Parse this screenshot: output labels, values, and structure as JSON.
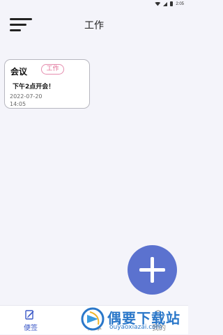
{
  "status_bar": {
    "time": "2:05"
  },
  "header": {
    "title": "工作",
    "menu_icon": "menu-icon"
  },
  "note_card": {
    "title": "会议",
    "tag": "工作",
    "body": "下午2点开会！",
    "date": "2022-07-20",
    "time": "14:05"
  },
  "fab": {
    "icon": "plus-icon"
  },
  "bottom_nav": {
    "items": [
      {
        "label": "便签",
        "icon": "note-edit-icon"
      },
      {
        "label": "账本",
        "icon": "ledger-icon"
      },
      {
        "label": "我的",
        "icon": "profile-icon"
      }
    ]
  },
  "watermark": {
    "text": "偶要下载站",
    "url": "ouyaoxiazai.com"
  },
  "colors": {
    "accent": "#5b72cf",
    "tag_pink": "#e06a93",
    "watermark_blue": "#2a77c9"
  }
}
